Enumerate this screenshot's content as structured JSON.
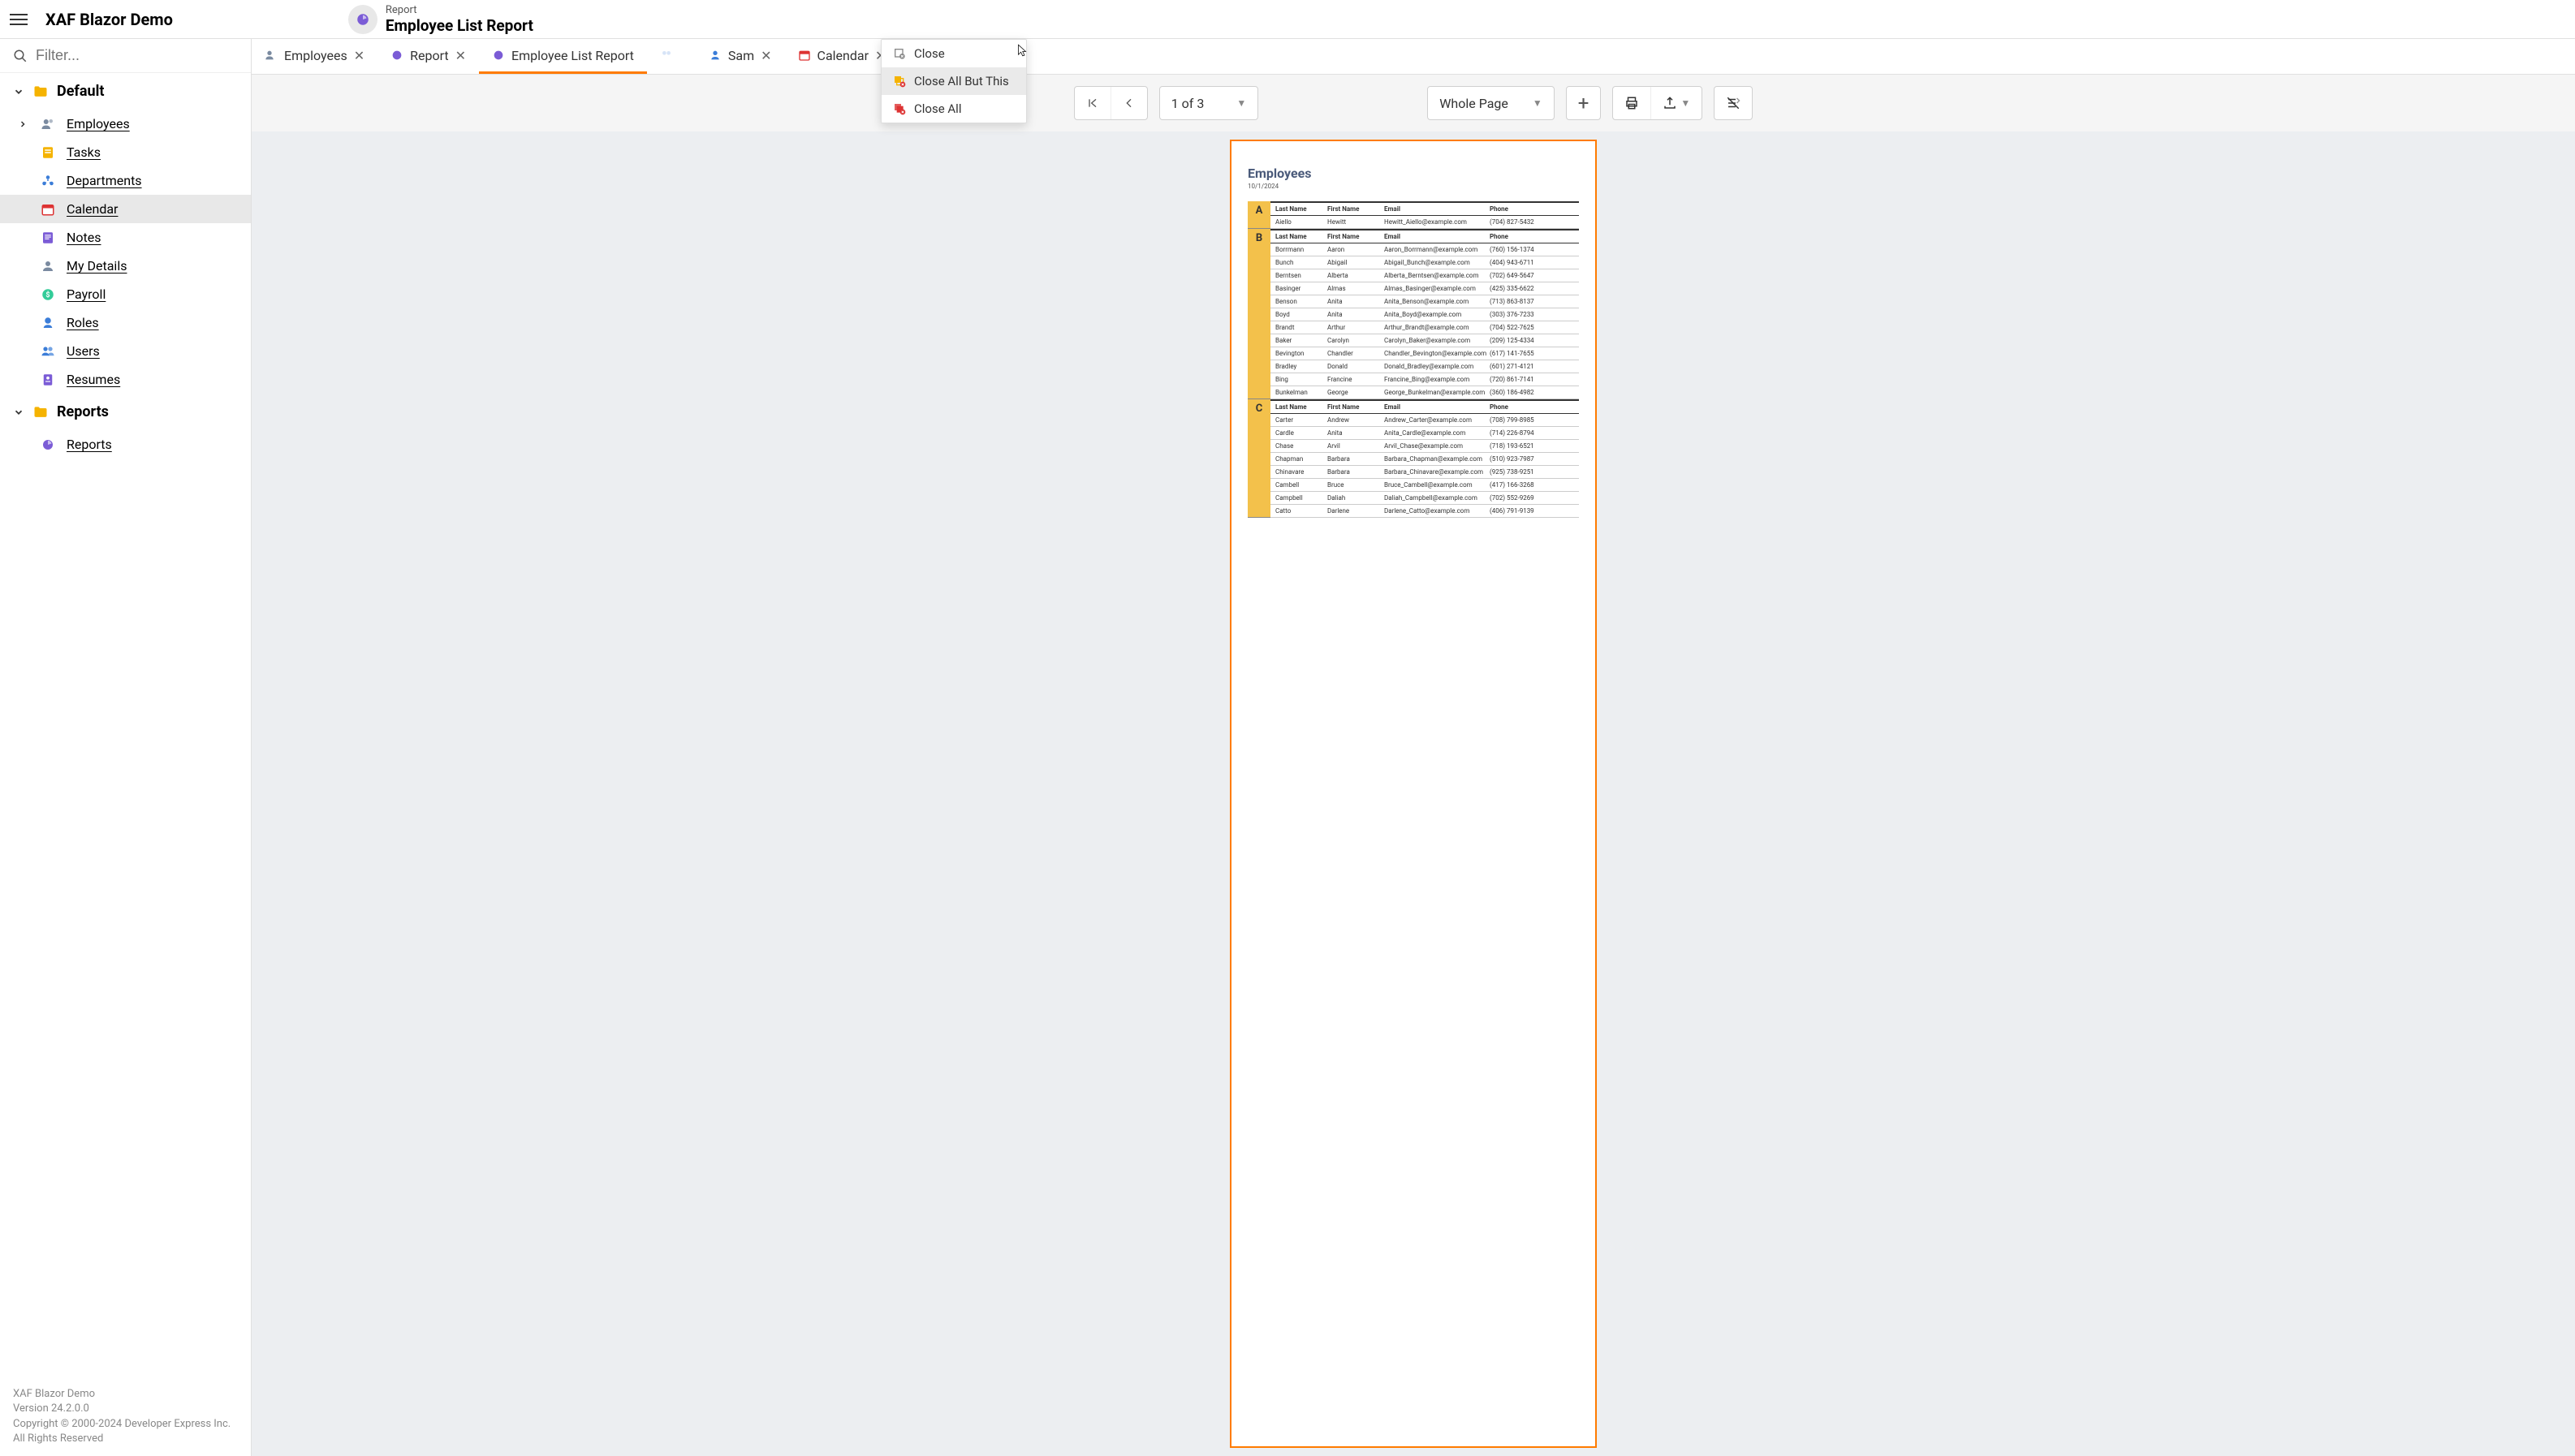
{
  "app": {
    "title": "XAF Blazor Demo"
  },
  "breadcrumb": {
    "top": "Report",
    "bottom": "Employee List Report"
  },
  "filter": {
    "placeholder": "Filter..."
  },
  "nav": {
    "group_default": "Default",
    "group_reports": "Reports",
    "items": {
      "employees": "Employees",
      "tasks": "Tasks",
      "departments": "Departments",
      "calendar": "Calendar",
      "notes": "Notes",
      "my_details": "My Details",
      "payroll": "Payroll",
      "roles": "Roles",
      "users": "Users",
      "resumes": "Resumes",
      "reports": "Reports"
    }
  },
  "footer": {
    "l1": "XAF Blazor Demo",
    "l2": "Version 24.2.0.0",
    "l3": "Copyright © 2000-2024 Developer Express Inc.",
    "l4": "All Rights Reserved"
  },
  "tabs": {
    "t0": "Employees",
    "t1": "Report",
    "t2": "Employee List Report",
    "t3": "Sam",
    "t4": "Calendar"
  },
  "ctx": {
    "close": "Close",
    "close_all_but": "Close All But This",
    "close_all": "Close All"
  },
  "toolbar": {
    "page_of": "1 of 3",
    "zoom_label": "Whole Page"
  },
  "report": {
    "title": "Employees",
    "date": "10/1/2024",
    "columns": {
      "last": "Last Name",
      "first": "First Name",
      "email": "Email",
      "phone": "Phone"
    },
    "sections": [
      {
        "letter": "A",
        "rows": [
          {
            "last": "Aiello",
            "first": "Hewitt",
            "email": "Hewitt_Aiello@example.com",
            "phone": "(704) 827-5432"
          }
        ]
      },
      {
        "letter": "B",
        "rows": [
          {
            "last": "Borrmann",
            "first": "Aaron",
            "email": "Aaron_Borrmann@example.com",
            "phone": "(760) 156-1374"
          },
          {
            "last": "Bunch",
            "first": "Abigail",
            "email": "Abigail_Bunch@example.com",
            "phone": "(404) 943-6711"
          },
          {
            "last": "Berntsen",
            "first": "Alberta",
            "email": "Alberta_Berntsen@example.com",
            "phone": "(702) 649-5647"
          },
          {
            "last": "Basinger",
            "first": "Almas",
            "email": "Almas_Basinger@example.com",
            "phone": "(425) 335-6622"
          },
          {
            "last": "Benson",
            "first": "Anita",
            "email": "Anita_Benson@example.com",
            "phone": "(713) 863-8137"
          },
          {
            "last": "Boyd",
            "first": "Anita",
            "email": "Anita_Boyd@example.com",
            "phone": "(303) 376-7233"
          },
          {
            "last": "Brandt",
            "first": "Arthur",
            "email": "Arthur_Brandt@example.com",
            "phone": "(704) 522-7625"
          },
          {
            "last": "Baker",
            "first": "Carolyn",
            "email": "Carolyn_Baker@example.com",
            "phone": "(209) 125-4334"
          },
          {
            "last": "Bevington",
            "first": "Chandler",
            "email": "Chandler_Bevington@example.com",
            "phone": "(617) 141-7655"
          },
          {
            "last": "Bradley",
            "first": "Donald",
            "email": "Donald_Bradley@example.com",
            "phone": "(601) 271-4121"
          },
          {
            "last": "Bing",
            "first": "Francine",
            "email": "Francine_Bing@example.com",
            "phone": "(720) 861-7141"
          },
          {
            "last": "Bunkelman",
            "first": "George",
            "email": "George_Bunkelman@example.com",
            "phone": "(360) 186-4982"
          }
        ]
      },
      {
        "letter": "C",
        "rows": [
          {
            "last": "Carter",
            "first": "Andrew",
            "email": "Andrew_Carter@example.com",
            "phone": "(708) 799-8985"
          },
          {
            "last": "Cardle",
            "first": "Anita",
            "email": "Anita_Cardle@example.com",
            "phone": "(714) 226-8794"
          },
          {
            "last": "Chase",
            "first": "Arvil",
            "email": "Arvil_Chase@example.com",
            "phone": "(718) 193-6521"
          },
          {
            "last": "Chapman",
            "first": "Barbara",
            "email": "Barbara_Chapman@example.com",
            "phone": "(510) 923-7987"
          },
          {
            "last": "Chinavare",
            "first": "Barbara",
            "email": "Barbara_Chinavare@example.com",
            "phone": "(925) 738-9251"
          },
          {
            "last": "Cambell",
            "first": "Bruce",
            "email": "Bruce_Cambell@example.com",
            "phone": "(417) 166-3268"
          },
          {
            "last": "Campbell",
            "first": "Daliah",
            "email": "Daliah_Campbell@example.com",
            "phone": "(702) 552-9269"
          },
          {
            "last": "Catto",
            "first": "Darlene",
            "email": "Darlene_Catto@example.com",
            "phone": "(406) 791-9139"
          }
        ]
      }
    ]
  }
}
